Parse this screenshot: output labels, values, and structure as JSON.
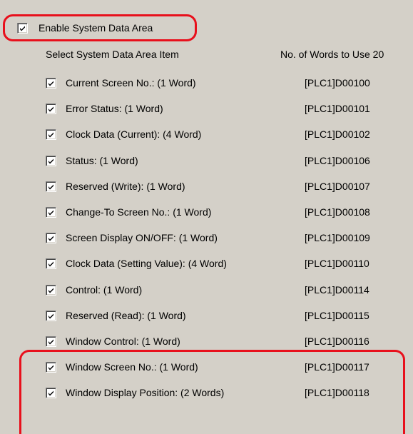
{
  "enable": {
    "label": "Enable System Data Area",
    "checked": true
  },
  "header": {
    "select_label": "Select System Data Area Item",
    "words_label": "No. of Words to Use 20"
  },
  "items": [
    {
      "label": "Current Screen No.: (1 Word)",
      "address": "[PLC1]D00100",
      "checked": true
    },
    {
      "label": "Error Status: (1 Word)",
      "address": "[PLC1]D00101",
      "checked": true
    },
    {
      "label": "Clock Data (Current): (4 Word)",
      "address": "[PLC1]D00102",
      "checked": true
    },
    {
      "label": "Status: (1 Word)",
      "address": "[PLC1]D00106",
      "checked": true
    },
    {
      "label": "Reserved (Write): (1 Word)",
      "address": "[PLC1]D00107",
      "checked": true
    },
    {
      "label": "Change-To Screen No.: (1 Word)",
      "address": "[PLC1]D00108",
      "checked": true
    },
    {
      "label": "Screen Display ON/OFF: (1 Word)",
      "address": "[PLC1]D00109",
      "checked": true
    },
    {
      "label": "Clock Data (Setting Value): (4 Word)",
      "address": "[PLC1]D00110",
      "checked": true
    },
    {
      "label": "Control: (1 Word)",
      "address": "[PLC1]D00114",
      "checked": true
    },
    {
      "label": "Reserved (Read): (1 Word)",
      "address": "[PLC1]D00115",
      "checked": true
    },
    {
      "label": "Window Control: (1 Word)",
      "address": "[PLC1]D00116",
      "checked": true
    },
    {
      "label": "Window Screen No.: (1 Word)",
      "address": "[PLC1]D00117",
      "checked": true
    },
    {
      "label": "Window Display Position: (2 Words)",
      "address": "[PLC1]D00118",
      "checked": true
    }
  ],
  "colors": {
    "highlight": "#e8101c",
    "panel": "#d4d0c8"
  }
}
